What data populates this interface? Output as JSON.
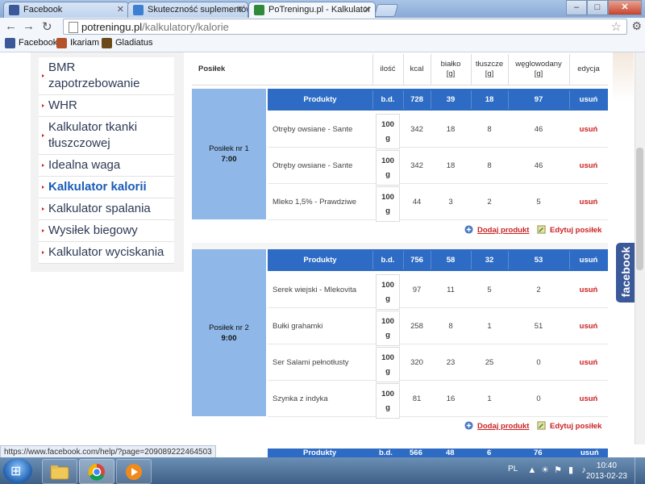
{
  "browser": {
    "tabs": [
      {
        "label": "Facebook",
        "icon": "facebook-icon"
      },
      {
        "label": "Skuteczność suplementów",
        "icon": "page-icon"
      },
      {
        "label": "PoTreningu.pl - Kalkulator",
        "icon": "potreningu-icon"
      }
    ],
    "url_host": "potreningu.pl",
    "url_path": "/kalkulatory/kalorie",
    "bookmarks": [
      "Facebook",
      "Ikariam",
      "Gladiatus"
    ],
    "status_url": "https://www.facebook.com/help/?page=209089222464503"
  },
  "sidebar": {
    "items": [
      {
        "label": "BMR zapotrzebowanie"
      },
      {
        "label": "WHR"
      },
      {
        "label": "Kalkulator tkanki tłuszczowej"
      },
      {
        "label": "Idealna waga"
      },
      {
        "label": "Kalkulator kalorii",
        "active": true
      },
      {
        "label": "Kalkulator spalania"
      },
      {
        "label": "Wysiłek biegowy"
      },
      {
        "label": "Kalkulator wyciskania"
      }
    ]
  },
  "table_header": {
    "meal": "Posiłek",
    "qty": "ilość",
    "kcal": "kcal",
    "protein": "białko [g]",
    "fat": "tłuszcze [g]",
    "carbs": "węglowodany [g]",
    "edit": "edycja"
  },
  "meals": [
    {
      "name": "Posiłek nr 1",
      "time": "7:00",
      "summary": {
        "label": "Produkty",
        "qty": "b.d.",
        "kcal": "728",
        "protein": "39",
        "fat": "18",
        "carbs": "97",
        "del": "usuń"
      },
      "products": [
        {
          "name": "Otręby owsiane - Sante",
          "qty_num": "100",
          "qty_unit": "g",
          "kcal": "342",
          "protein": "18",
          "fat": "8",
          "carbs": "46",
          "del": "usuń"
        },
        {
          "name": "Otręby owsiane - Sante",
          "qty_num": "100",
          "qty_unit": "g",
          "kcal": "342",
          "protein": "18",
          "fat": "8",
          "carbs": "46",
          "del": "usuń"
        },
        {
          "name": "Mleko 1,5% - Prawdziwe",
          "qty_num": "100",
          "qty_unit": "g",
          "kcal": "44",
          "protein": "3",
          "fat": "2",
          "carbs": "5",
          "del": "usuń"
        }
      ],
      "add_label": "Dodaj produkt",
      "edit_label": "Edytuj posiłek"
    },
    {
      "name": "Posiłek nr 2",
      "time": "9:00",
      "summary": {
        "label": "Produkty",
        "qty": "b.d.",
        "kcal": "756",
        "protein": "58",
        "fat": "32",
        "carbs": "53",
        "del": "usuń"
      },
      "products": [
        {
          "name": "Serek wiejski - Mlekovita",
          "qty_num": "100",
          "qty_unit": "g",
          "kcal": "97",
          "protein": "11",
          "fat": "5",
          "carbs": "2",
          "del": "usuń"
        },
        {
          "name": "Bułki grahamki",
          "qty_num": "100",
          "qty_unit": "g",
          "kcal": "258",
          "protein": "8",
          "fat": "1",
          "carbs": "51",
          "del": "usuń"
        },
        {
          "name": "Ser Salami pełnotłusty",
          "qty_num": "100",
          "qty_unit": "g",
          "kcal": "320",
          "protein": "23",
          "fat": "25",
          "carbs": "0",
          "del": "usuń"
        },
        {
          "name": "Szynka z indyka",
          "qty_num": "100",
          "qty_unit": "g",
          "kcal": "81",
          "protein": "16",
          "fat": "1",
          "carbs": "0",
          "del": "usuń"
        }
      ],
      "add_label": "Dodaj produkt",
      "edit_label": "Edytuj posiłek"
    },
    {
      "summary": {
        "label": "Produkty",
        "qty": "b.d.",
        "kcal": "566",
        "protein": "48",
        "fat": "6",
        "carbs": "76",
        "del": "usuń"
      }
    }
  ],
  "facebook_tab": "facebook",
  "taskbar": {
    "lang": "PL",
    "time": "10:40",
    "date": "2013-02-23"
  },
  "colors": {
    "header_blue": "#2d6bc4",
    "meal_label": "#8fb8e8",
    "delete_red": "#cc2222",
    "facebook": "#3b5998"
  }
}
